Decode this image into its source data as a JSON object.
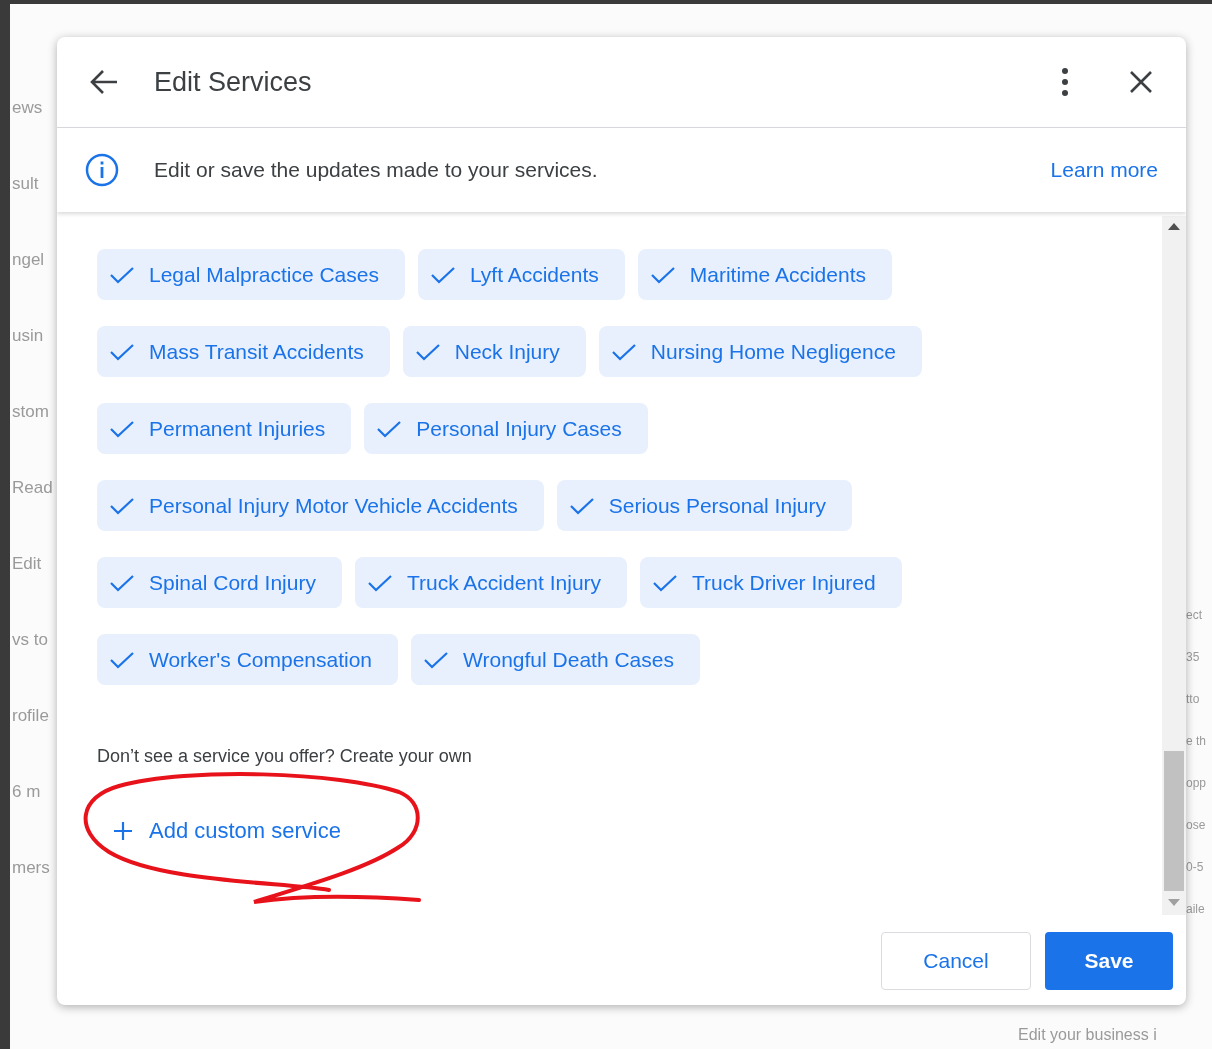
{
  "background": {
    "left_fragments": [
      "ews",
      "sult",
      "ngel",
      "usin",
      "stom",
      "Read",
      "Edit",
      "vs to",
      "rofile",
      "6 m",
      "mers"
    ],
    "right_fragments": [
      "ect",
      "35",
      "tto",
      "e th",
      "opp",
      "ose",
      "0-5",
      "aile"
    ],
    "bottom_text": "Edit your business i"
  },
  "dialog": {
    "title": "Edit Services",
    "info": {
      "text": "Edit or save the updates made to your services.",
      "link": "Learn more"
    },
    "services": [
      {
        "label": "Legal Malpractice Cases",
        "checked": true
      },
      {
        "label": "Lyft Accidents",
        "checked": true
      },
      {
        "label": "Maritime Accidents",
        "checked": true
      },
      {
        "label": "Mass Transit Accidents",
        "checked": true
      },
      {
        "label": "Neck Injury",
        "checked": true
      },
      {
        "label": "Nursing Home Negligence",
        "checked": true
      },
      {
        "label": "Permanent Injuries",
        "checked": true
      },
      {
        "label": "Personal Injury Cases",
        "checked": true
      },
      {
        "label": "Personal Injury Motor Vehicle Accidents",
        "checked": true
      },
      {
        "label": "Serious Personal Injury",
        "checked": true
      },
      {
        "label": "Spinal Cord Injury",
        "checked": true
      },
      {
        "label": "Truck Accident Injury",
        "checked": true
      },
      {
        "label": "Truck Driver Injured",
        "checked": true
      },
      {
        "label": "Worker's Compensation",
        "checked": true
      },
      {
        "label": "Wrongful Death Cases",
        "checked": true
      }
    ],
    "custom_prompt": "Don’t see a service you offer? Create your own",
    "add_custom": "Add custom service",
    "buttons": {
      "cancel": "Cancel",
      "save": "Save"
    }
  }
}
